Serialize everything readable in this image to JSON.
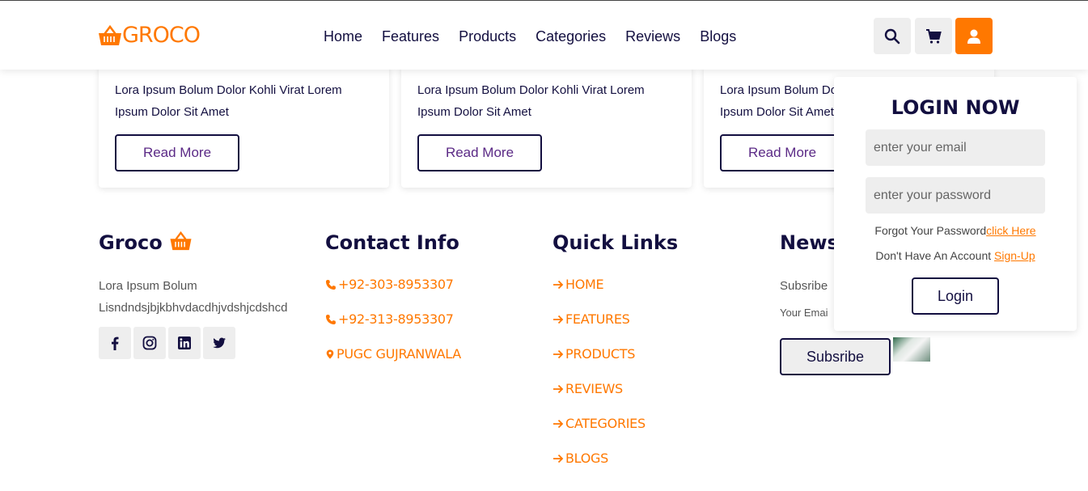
{
  "header": {
    "logo_text": "GROCO",
    "nav": [
      "Home",
      "Features",
      "Products",
      "Categories",
      "Reviews",
      "Blogs"
    ],
    "icons": [
      "search-icon",
      "cart-icon",
      "user-icon"
    ]
  },
  "cards": [
    {
      "text": "Lora Ipsum Bolum Dolor Kohli Virat Lorem Ipsum Dolor Sit Amet",
      "button": "Read More"
    },
    {
      "text": "Lora Ipsum Bolum Dolor Kohli Virat Lorem Ipsum Dolor Sit Amet",
      "button": "Read More"
    },
    {
      "text": "Lora Ipsum Bolum Dolor Kohli Virat Lorem Ipsum Dolor Sit Amet",
      "button": "Read More"
    }
  ],
  "footer": {
    "brand": {
      "title": "Groco",
      "text_line1": "Lora Ipsum Bolum",
      "text_line2": "Lisndndsjbjkbhvdacdhjvdshjcdshcd",
      "socials": [
        "facebook-icon",
        "instagram-icon",
        "linkedin-icon",
        "twitter-icon"
      ]
    },
    "contact": {
      "title": "Contact Info",
      "phone1": "+92-303-8953307",
      "phone2": "+92-313-8953307",
      "address": "PUGC GUJRANWALA"
    },
    "quick_links": {
      "title": "Quick Links",
      "links": [
        "HOME",
        "FEATURES",
        "PRODUCTS",
        "REVIEWS",
        "CATEGORIES",
        "BLOGS"
      ]
    },
    "newsletter": {
      "title": "News",
      "text": "Subsribe",
      "email_placeholder": "Your Emai",
      "button": "Subsribe"
    }
  },
  "login": {
    "title": "LOGIN NOW",
    "email_placeholder": "enter your email",
    "password_placeholder": "enter your password",
    "forgot_text": "Forgot Your Password",
    "forgot_link": "click Here",
    "account_text": "Don't Have An Account ",
    "signup_link": "Sign-Up",
    "button": "Login"
  },
  "colors": {
    "accent": "#ff7800",
    "dark": "#130f40",
    "light_bg": "#eeeeee"
  }
}
